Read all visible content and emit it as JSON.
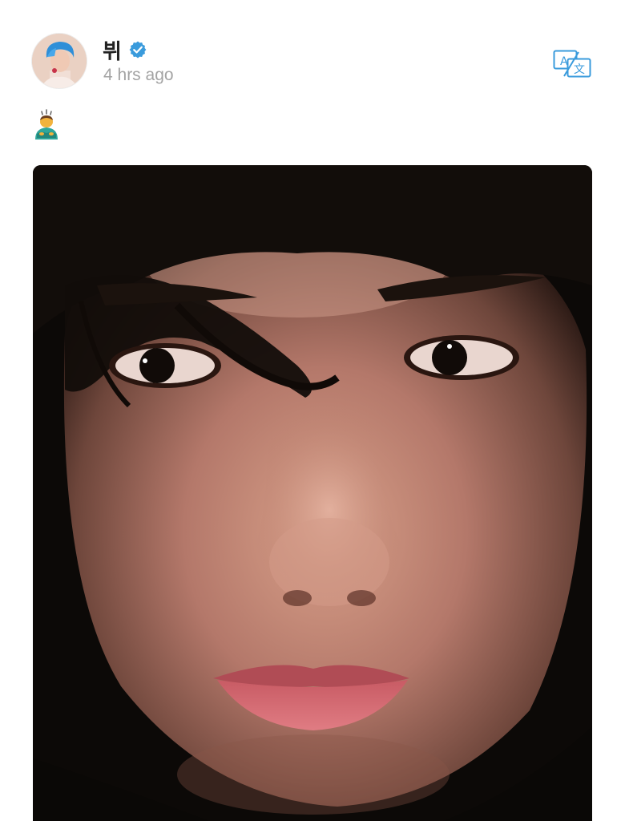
{
  "post": {
    "author": {
      "name": "뷔",
      "verified": true,
      "avatar": "avatar-photo-blue-hair"
    },
    "timestamp": "4 hrs ago",
    "text": "🙇‍♂️",
    "translate_icon": "translate-icon",
    "image": "selfie-photo"
  },
  "colors": {
    "verified_badge": "#3a9bdc",
    "translate_icon": "#3a9bdc",
    "timestamp": "#a3a3a3",
    "name": "#222222"
  }
}
